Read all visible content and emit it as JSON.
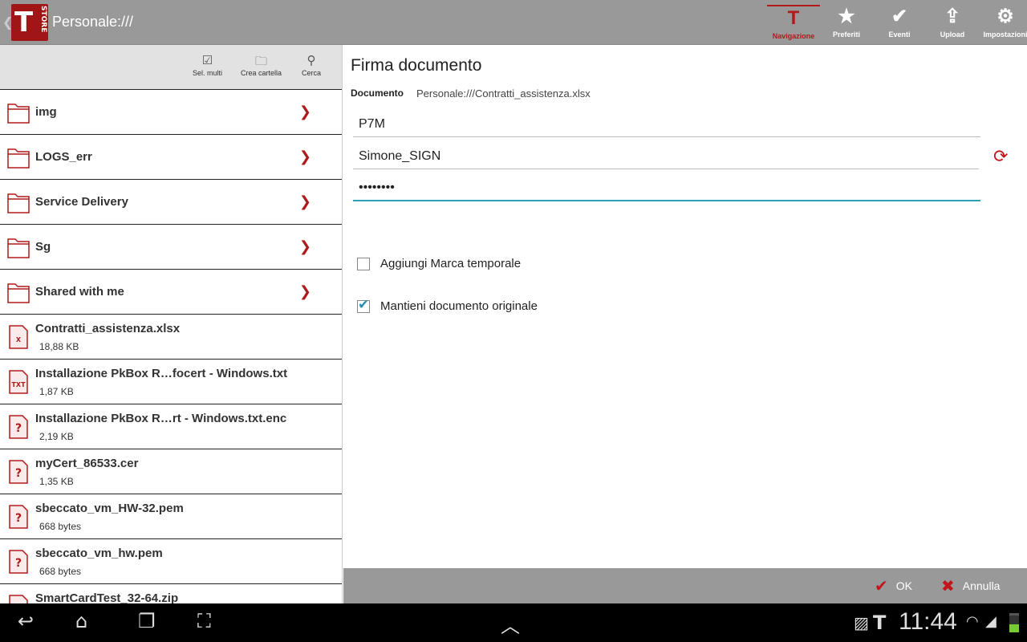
{
  "header": {
    "title": "Personale:///",
    "logo_text": "T4 STORE"
  },
  "nav": [
    {
      "label": "Navigazione",
      "icon": "t4-icon",
      "active": true
    },
    {
      "label": "Preferiti",
      "icon": "star-icon"
    },
    {
      "label": "Eventi",
      "icon": "check-icon"
    },
    {
      "label": "Upload",
      "icon": "upload-icon"
    },
    {
      "label": "Impostazioni",
      "icon": "gear-icon"
    }
  ],
  "toolbar": {
    "multi": "Sel. multi",
    "new_folder": "Crea cartella",
    "search": "Cerca"
  },
  "folders": [
    {
      "name": "img"
    },
    {
      "name": "LOGS_err"
    },
    {
      "name": "Service Delivery"
    },
    {
      "name": "Sg"
    },
    {
      "name": "Shared with me"
    }
  ],
  "files": [
    {
      "name": "Contratti_assistenza.xlsx",
      "size": "18,88 KB",
      "type": "xls"
    },
    {
      "name": "Installazione PkBox R…focert - Windows.txt",
      "size": "1,87 KB",
      "type": "txt"
    },
    {
      "name": "Installazione PkBox R…rt - Windows.txt.enc",
      "size": "2,19 KB",
      "type": "unknown"
    },
    {
      "name": "myCert_86533.cer",
      "size": "1,35 KB",
      "type": "unknown"
    },
    {
      "name": "sbeccato_vm_HW-32.pem",
      "size": "668 bytes",
      "type": "unknown"
    },
    {
      "name": "sbeccato_vm_hw.pem",
      "size": "668 bytes",
      "type": "unknown"
    },
    {
      "name": "SmartCardTest_32-64.zip",
      "size": "",
      "type": "zip"
    }
  ],
  "form": {
    "title": "Firma documento",
    "doc_label": "Documento",
    "doc_value": "Personale:///Contratti_assistenza.xlsx",
    "format": "P7M",
    "user": "Simone_SIGN",
    "password": "••••••••",
    "timestamp_label": "Aggiungi Marca temporale",
    "timestamp_checked": false,
    "keep_label": "Mantieni documento originale",
    "keep_checked": true
  },
  "actions": {
    "ok": "OK",
    "cancel": "Annulla"
  },
  "status": {
    "time": "11:44"
  },
  "colors": {
    "accent": "#b01a1a",
    "focus": "#2aa0b8"
  }
}
